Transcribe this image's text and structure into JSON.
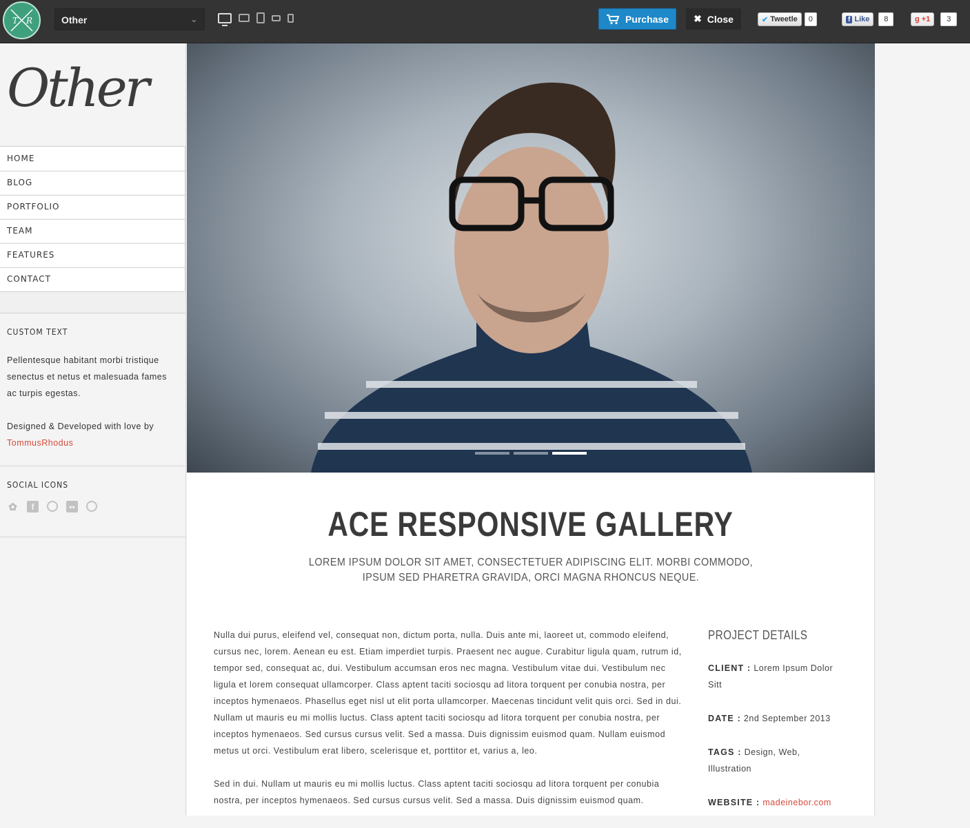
{
  "topbar": {
    "logo_letters": [
      "T",
      "R"
    ],
    "theme_select_value": "Other",
    "devices": [
      "desktop",
      "tablet-landscape",
      "tablet-portrait",
      "phone-landscape",
      "phone-portrait"
    ],
    "purchase_label": "Purchase",
    "close_label": "Close",
    "tweet_label": "Tweetle",
    "tweet_count": "0",
    "like_label": "Like",
    "like_count": "8",
    "plusone_label": "+1",
    "plusone_count": "3"
  },
  "sidebar": {
    "logo_text": "Other",
    "nav": [
      "HOME",
      "BLOG",
      "PORTFOLIO",
      "TEAM",
      "FEATURES",
      "CONTACT"
    ],
    "custom_text": {
      "title": "CUSTOM TEXT",
      "paragraph": "Pellentesque habitant morbi tristique senectus et netus et malesuada fames ac turpis egestas.",
      "credit": "Designed & Developed with love by",
      "credit_link": "TommusRhodus"
    },
    "social": {
      "title": "SOCIAL ICONS",
      "icons": [
        "twitter-icon",
        "facebook-icon",
        "dribbble-icon",
        "flickr-icon",
        "github-icon"
      ]
    }
  },
  "hero": {
    "slides": 3,
    "active_slide": 3
  },
  "project": {
    "title": "ACE RESPONSIVE GALLERY",
    "subtitle": "LOREM IPSUM DOLOR SIT AMET, CONSECTETUER ADIPISCING ELIT. MORBI COMMODO, IPSUM SED PHARETRA GRAVIDA, ORCI MAGNA RHONCUS NEQUE.",
    "paragraphs": [
      "Nulla dui purus, eleifend vel, consequat non, dictum porta, nulla. Duis ante mi, laoreet ut, commodo eleifend, cursus nec, lorem. Aenean eu est. Etiam imperdiet turpis. Praesent nec augue. Curabitur ligula quam, rutrum id, tempor sed, consequat ac, dui. Vestibulum accumsan eros nec magna. Vestibulum vitae dui. Vestibulum nec ligula et lorem consequat ullamcorper. Class aptent taciti sociosqu ad litora torquent per conubia nostra, per inceptos hymenaeos. Phasellus eget nisl ut elit porta ullamcorper. Maecenas tincidunt velit quis orci. Sed in dui. Nullam ut mauris eu mi mollis luctus. Class aptent taciti sociosqu ad litora torquent per conubia nostra, per inceptos hymenaeos. Sed cursus cursus velit. Sed a massa. Duis dignissim euismod quam. Nullam euismod metus ut orci. Vestibulum erat libero, scelerisque et, porttitor et, varius a, leo.",
      "Sed in dui. Nullam ut mauris eu mi mollis luctus. Class aptent taciti sociosqu ad litora torquent per conubia nostra, per inceptos hymenaeos. Sed cursus cursus velit. Sed a massa. Duis dignissim euismod quam."
    ],
    "details_title": "PROJECT DETAILS",
    "client_label": "CLIENT :",
    "client_value": "Lorem Ipsum Dolor Sitt",
    "date_label": "DATE :",
    "date_value": "2nd September 2013",
    "tags_label": "TAGS :",
    "tags_value": "Design, Web, Illustration",
    "website_label": "WEBSITE :",
    "website_value": "madeinebor.com"
  },
  "colors": {
    "accent": "#d64a38",
    "purchase": "#1e88c9",
    "topbar": "#343434",
    "logo_badge": "#3fa07e"
  }
}
